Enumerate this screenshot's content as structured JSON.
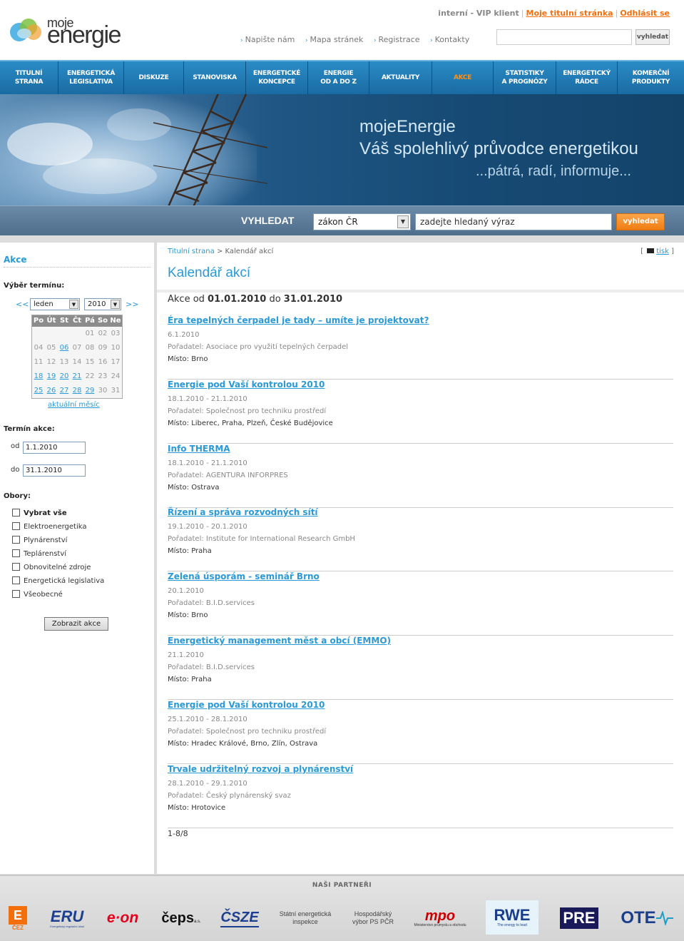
{
  "header": {
    "logo_top": "moje",
    "logo_bottom": "energie",
    "interni": "interní - VIP klient",
    "moje_titulni": "Moje titulní stránka",
    "odhlasit": "Odhlásit se",
    "subnav": [
      "Napište nám",
      "Mapa stránek",
      "Registrace",
      "Kontakty"
    ],
    "search_button": "vyhledat"
  },
  "nav": [
    {
      "line1": "TITULNÍ",
      "line2": "STRANA"
    },
    {
      "line1": "ENERGETICKÁ",
      "line2": "LEGISLATIVA"
    },
    {
      "line1": "DISKUZE",
      "line2": ""
    },
    {
      "line1": "STANOVISKA",
      "line2": ""
    },
    {
      "line1": "ENERGETICKÉ",
      "line2": "KONCEPCE"
    },
    {
      "line1": "ENERGIE",
      "line2": "OD A DO Z"
    },
    {
      "line1": "AKTUALITY",
      "line2": ""
    },
    {
      "line1": "AKCE",
      "line2": ""
    },
    {
      "line1": "STATISTIKY",
      "line2": "A PROGNÓZY"
    },
    {
      "line1": "ENERGETICKÝ",
      "line2": "RÁDCE"
    },
    {
      "line1": "KOMERČNÍ",
      "line2": "PRODUKTY"
    }
  ],
  "colors": {
    "accent": "#2a9ad6",
    "orange": "#f26f0c",
    "nav": "#1a6ba3"
  },
  "banner": {
    "line1": "mojeEnergie",
    "line2": "Váš spolehlivý průvodce energetikou",
    "line3": "...pátrá, radí, informuje..."
  },
  "search": {
    "label": "VYHLEDAT",
    "select_value": "zákon ČR",
    "placeholder": "zadejte hledaný výraz",
    "button": "vyhledat"
  },
  "sidebar": {
    "title": "Akce",
    "vyber_label": "Výběr termínu:",
    "prev": "<<",
    "next": ">>",
    "month": "leden",
    "year": "2010",
    "days_header": [
      "Po",
      "Út",
      "St",
      "Čt",
      "Pá",
      "So",
      "Ne"
    ],
    "weeks": [
      [
        "",
        "",
        "",
        "",
        "01",
        "02",
        "03"
      ],
      [
        "04",
        "05",
        "06",
        "07",
        "08",
        "09",
        "10"
      ],
      [
        "11",
        "12",
        "13",
        "14",
        "15",
        "16",
        "17"
      ],
      [
        "18",
        "19",
        "20",
        "21",
        "22",
        "23",
        "24"
      ],
      [
        "25",
        "26",
        "27",
        "28",
        "29",
        "30",
        "31"
      ]
    ],
    "linked_days": [
      "06",
      "18",
      "19",
      "20",
      "21",
      "25",
      "26",
      "27",
      "28",
      "29"
    ],
    "aktualni": "aktuální měsíc",
    "termin_label": "Termín akce:",
    "od_label": "od",
    "od_value": "1.1.2010",
    "do_label": "do",
    "do_value": "31.1.2010",
    "obory_label": "Obory:",
    "obory": [
      "Vybrat vše",
      "Elektroenergetika",
      "Plynárenství",
      "Teplárenství",
      "Obnovitelné zdroje",
      "Energetická legislativa",
      "Všeobecné"
    ],
    "show_button": "Zobrazit akce"
  },
  "content": {
    "crumb_home": "Titulní strana",
    "crumb_sep": ">",
    "crumb_current": "Kalendář akcí",
    "print": "tisk",
    "title": "Kalendář akcí",
    "range_prefix": "Akce od",
    "range_from": "01.01.2010",
    "range_mid": "do",
    "range_to": "31.01.2010",
    "events": [
      {
        "title": "Éra tepelných čerpadel je tady – umíte je projektovat?",
        "date": "6.1.2010",
        "org": "Pořadatel: Asociace pro využití tepelných čerpadel",
        "place": "Místo: Brno"
      },
      {
        "title": "Energie pod Vaší kontrolou 2010",
        "date": "18.1.2010 - 21.1.2010",
        "org": "Pořadatel: Společnost pro techniku prostředí",
        "place": "Místo: Liberec, Praha, Plzeň, České Budějovice"
      },
      {
        "title": "Info THERMA",
        "date": "18.1.2010 - 21.1.2010",
        "org": "Pořadatel: AGENTURA INFORPRES",
        "place": "Místo: Ostrava"
      },
      {
        "title": "Řízení a správa rozvodných sítí",
        "date": "19.1.2010 - 20.1.2010",
        "org": "Pořadatel: Institute for International Research GmbH",
        "place": "Místo: Praha"
      },
      {
        "title": "Zelená úsporám - seminář Brno",
        "date": "20.1.2010",
        "org": "Pořadatel: B.I.D.services",
        "place": "Místo: Brno"
      },
      {
        "title": "Energetický management měst a obcí (EMMO)",
        "date": "21.1.2010",
        "org": "Pořadatel: B.I.D.services",
        "place": "Místo: Praha"
      },
      {
        "title": "Energie pod Vaší kontrolou 2010",
        "date": "25.1.2010 - 28.1.2010",
        "org": "Pořadatel: Společnost pro techniku prostředí",
        "place": "Místo: Hradec Králové, Brno, Zlín, Ostrava"
      },
      {
        "title": "Trvale udržitelný rozvoj a plynárenství",
        "date": "28.1.2010 - 29.1.2010",
        "org": "Pořadatel: Český plynárenský svaz",
        "place": "Místo: Hrotovice"
      }
    ],
    "pager": "1-8/8"
  },
  "partners": {
    "title": "NAŠI PARTNEŘI",
    "logos": [
      "ČEZ",
      "ERU",
      "e·on",
      "čeps",
      "ČSZE",
      "Státní energetická inspekce",
      "Hospodářský výbor PS PČR",
      "mpo",
      "RWE",
      "PRE",
      "OTE"
    ],
    "eru_sub": "Energetický regulační úřad",
    "mpo_sub": "Ministerstvo průmyslu a obchodu",
    "rwe_sub": "The energy to lead",
    "ceps_sub": "a.s."
  }
}
